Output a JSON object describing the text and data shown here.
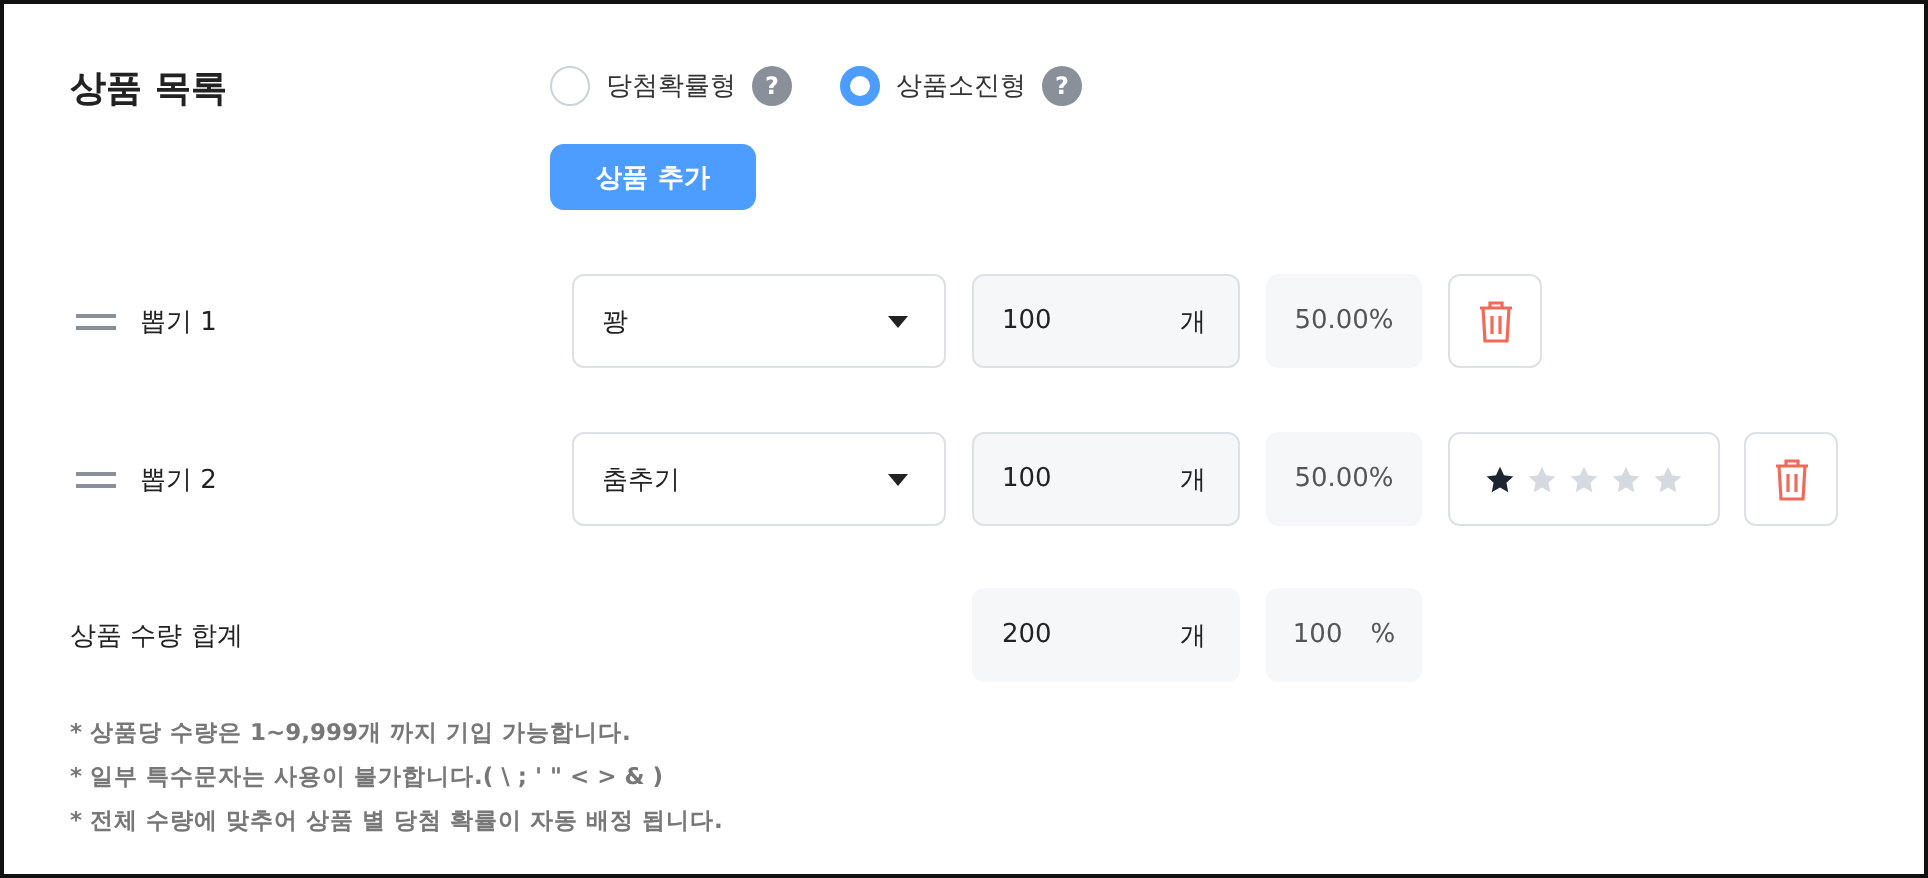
{
  "title": "상품 목록",
  "modes": [
    {
      "label": "당첨확률형",
      "selected": false,
      "help": "?"
    },
    {
      "label": "상품소진형",
      "selected": true,
      "help": "?"
    }
  ],
  "add_button": "상품 추가",
  "items": [
    {
      "label": "뽑기 1",
      "choice": "꽝",
      "quantity": "100",
      "unit": "개",
      "percent": "50.00%"
    },
    {
      "label": "뽑기 2",
      "choice": "춤추기",
      "quantity": "100",
      "unit": "개",
      "percent": "50.00%",
      "stars": 1
    }
  ],
  "total": {
    "label": "상품 수량 합계",
    "quantity": "200",
    "unit": "개",
    "percent": "100",
    "percent_unit": "%"
  },
  "notes": [
    "* 상품당 수량은 1~9,999개 까지 기입 가능합니다.",
    "* 일부 특수문자는 사용이 불가합니다.( \\ ; ' \" < > & )",
    "* 전체 수량에 맞추어 상품 별 당첨 확률이 자동 배정 됩니다."
  ]
}
